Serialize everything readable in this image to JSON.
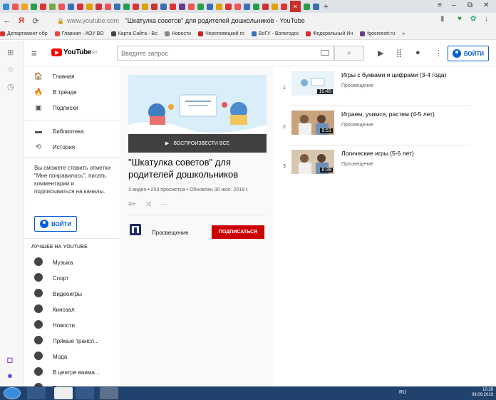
{
  "browser": {
    "tab_title": "\"Шкатулка советов\" для родителей дошкольников - YouTube",
    "url_host": "www.youtube.com",
    "bookmarks": [
      {
        "label": "Департамент обр",
        "color": "#d33"
      },
      {
        "label": "Главная - АОУ ВО",
        "color": "#e44"
      },
      {
        "label": "Карта Сайта - Во",
        "color": "#444"
      },
      {
        "label": "Новости",
        "color": "#888"
      },
      {
        "label": "Череповецкий го",
        "color": "#c22"
      },
      {
        "label": "ВоГУ - Вологодск",
        "color": "#3b6fb6"
      },
      {
        "label": "Федеральный Ин",
        "color": "#c33"
      },
      {
        "label": "fgosreestr.ru",
        "color": "#6a3b8a"
      }
    ],
    "bookmarks_more": "»"
  },
  "masthead": {
    "logo_text": "YouTube",
    "logo_region": "RU",
    "search_placeholder": "Введите запрос",
    "signin_label": "ВОЙТИ"
  },
  "guide": {
    "main_items": [
      {
        "label": "Главная",
        "icon": "home-icon",
        "glyph": "🏠"
      },
      {
        "label": "В тренде",
        "icon": "trending-icon",
        "glyph": "🔥"
      },
      {
        "label": "Подписки",
        "icon": "subscriptions-icon",
        "glyph": "▣"
      }
    ],
    "library_items": [
      {
        "label": "Библиотека",
        "icon": "library-icon",
        "glyph": "▬"
      },
      {
        "label": "История",
        "icon": "history-icon",
        "glyph": "⟲"
      }
    ],
    "signin_note": "Вы сможете ставить отметки \"Мне понравилось\", писать комментарии и подписываться на каналы.",
    "signin_label": "ВОЙТИ",
    "best_heading": "ЛУЧШЕЕ НА YOUTUBE",
    "best_items": [
      {
        "label": "Музыка",
        "icon": "music-icon"
      },
      {
        "label": "Спорт",
        "icon": "sport-icon"
      },
      {
        "label": "Видеоигры",
        "icon": "gaming-icon"
      },
      {
        "label": "Кинозал",
        "icon": "movies-icon"
      },
      {
        "label": "Новости",
        "icon": "news-icon"
      },
      {
        "label": "Прямые трансл...",
        "icon": "live-icon"
      },
      {
        "label": "Мода",
        "icon": "fashion-icon"
      },
      {
        "label": "В центре внима...",
        "icon": "spotlight-icon"
      },
      {
        "label": "Панорамные ви...",
        "icon": "panorama-icon"
      }
    ]
  },
  "playlist": {
    "play_all": "ВОСПРОИЗВЕСТИ ВСЕ",
    "title": "\"Шкатулка советов\" для родителей дошкольников",
    "meta": "3 видео • 253 просмотра • Обновлен 30 июл. 2019 г.",
    "channel": "Просвещение",
    "subscribe_label": "ПОДПИСАТЬСЯ"
  },
  "videos": [
    {
      "num": "1",
      "title": "Игры с буквами и цифрами (3-4 года)",
      "channel": "Просвещение",
      "duration": "10:45",
      "bg": "#e8f3fa"
    },
    {
      "num": "2",
      "title": "Играем, учимся, растем (4-5 лет)",
      "channel": "Просвещение",
      "duration": "9:51",
      "bg": "#c9a27e"
    },
    {
      "num": "3",
      "title": "Логические игры (5-6 лет)",
      "channel": "Просвещение",
      "duration": "8:38",
      "bg": "#d8c7b0"
    }
  ],
  "taskbar": {
    "lang": "RU",
    "time": "10:29",
    "date": "09.09.2019"
  }
}
